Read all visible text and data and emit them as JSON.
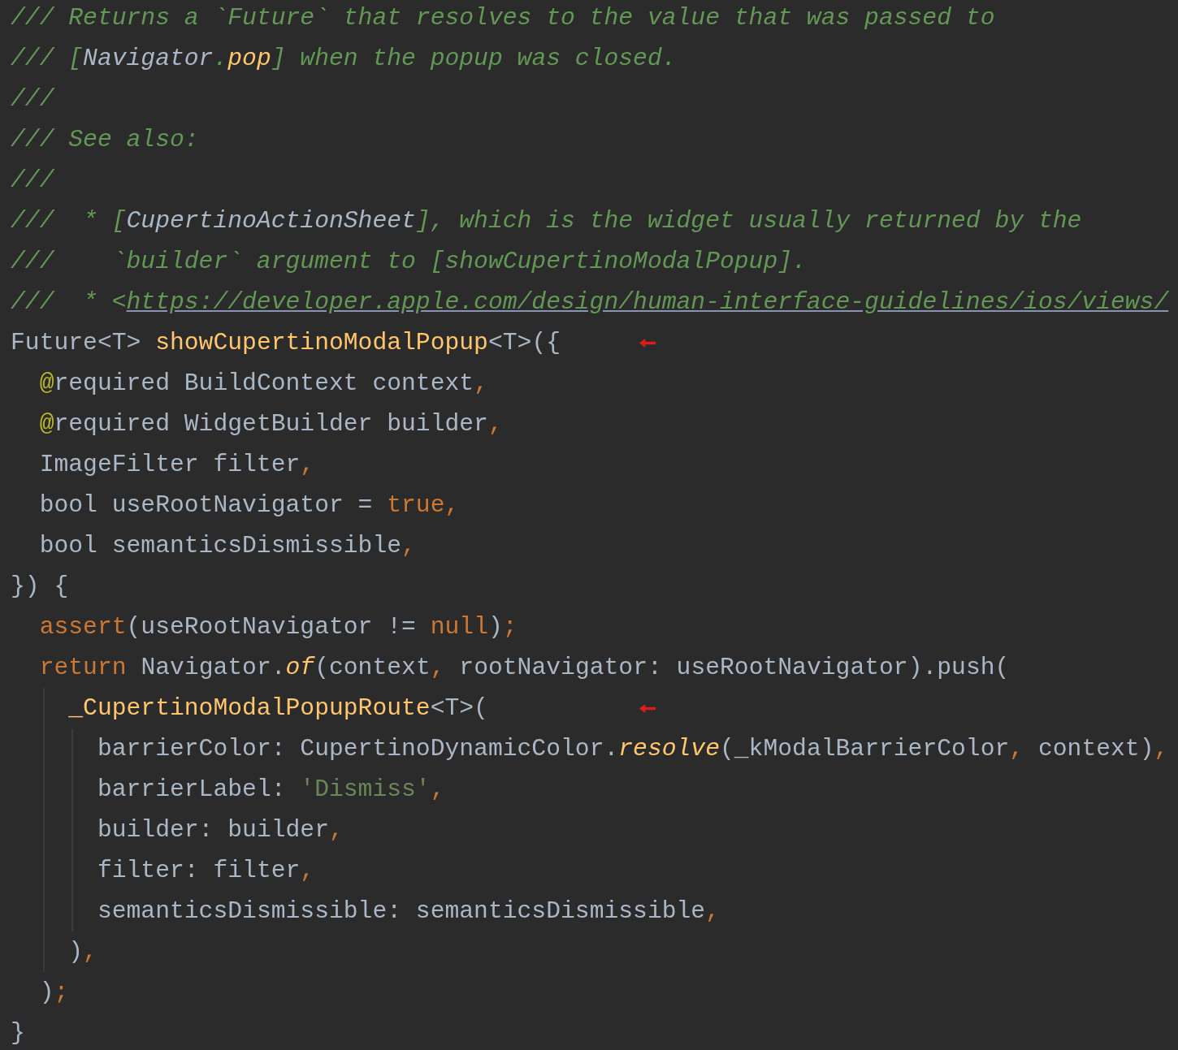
{
  "editor": {
    "lines": [
      {
        "tokens": [
          {
            "kind": "comment",
            "text": "/// Returns a `Future` that resolves to the value that was passed to"
          }
        ]
      },
      {
        "tokens": [
          {
            "kind": "comment",
            "text": "/// ["
          },
          {
            "kind": "comment-ref",
            "text": "Navigator"
          },
          {
            "kind": "comment",
            "text": "."
          },
          {
            "kind": "comment-ref-method",
            "text": "pop"
          },
          {
            "kind": "comment",
            "text": "] when the popup was closed."
          }
        ]
      },
      {
        "tokens": [
          {
            "kind": "comment",
            "text": "///"
          }
        ]
      },
      {
        "tokens": [
          {
            "kind": "comment",
            "text": "/// See also:"
          }
        ]
      },
      {
        "tokens": [
          {
            "kind": "comment",
            "text": "///"
          }
        ]
      },
      {
        "tokens": [
          {
            "kind": "comment",
            "text": "///  * ["
          },
          {
            "kind": "comment-ref",
            "text": "CupertinoActionSheet"
          },
          {
            "kind": "comment",
            "text": "], which is the widget usually returned by the"
          }
        ]
      },
      {
        "tokens": [
          {
            "kind": "comment",
            "text": "///    `builder` argument to [showCupertinoModalPopup]."
          }
        ]
      },
      {
        "tokens": [
          {
            "kind": "comment",
            "text": "///  * <"
          },
          {
            "kind": "link",
            "text": "https://developer.apple.com/design/human-interface-guidelines/ios/views/"
          }
        ]
      },
      {
        "marker": true,
        "tokens": [
          {
            "kind": "plain",
            "text": "Future<T> "
          },
          {
            "kind": "function",
            "text": "showCupertinoModalPopup"
          },
          {
            "kind": "plain",
            "text": "<T>({"
          }
        ]
      },
      {
        "tokens": [
          {
            "kind": "annotation",
            "text": "  @"
          },
          {
            "kind": "plain",
            "text": "required BuildContext context"
          },
          {
            "kind": "punct",
            "text": ","
          }
        ]
      },
      {
        "tokens": [
          {
            "kind": "annotation",
            "text": "  @"
          },
          {
            "kind": "plain",
            "text": "required WidgetBuilder builder"
          },
          {
            "kind": "punct",
            "text": ","
          }
        ]
      },
      {
        "tokens": [
          {
            "kind": "plain",
            "text": "  ImageFilter filter"
          },
          {
            "kind": "punct",
            "text": ","
          }
        ]
      },
      {
        "tokens": [
          {
            "kind": "plain",
            "text": "  bool useRootNavigator = "
          },
          {
            "kind": "keyword",
            "text": "true"
          },
          {
            "kind": "punct",
            "text": ","
          }
        ]
      },
      {
        "tokens": [
          {
            "kind": "plain",
            "text": "  bool semanticsDismissible"
          },
          {
            "kind": "punct",
            "text": ","
          }
        ]
      },
      {
        "tokens": [
          {
            "kind": "plain",
            "text": "}) {"
          }
        ]
      },
      {
        "tokens": [
          {
            "kind": "keyword",
            "text": "  assert"
          },
          {
            "kind": "plain",
            "text": "(useRootNavigator != "
          },
          {
            "kind": "keyword",
            "text": "null"
          },
          {
            "kind": "plain",
            "text": ")"
          },
          {
            "kind": "punct",
            "text": ";"
          }
        ]
      },
      {
        "tokens": [
          {
            "kind": "keyword",
            "text": "  return"
          },
          {
            "kind": "plain",
            "text": " Navigator."
          },
          {
            "kind": "method-italic",
            "text": "of"
          },
          {
            "kind": "plain",
            "text": "(context"
          },
          {
            "kind": "punct",
            "text": ","
          },
          {
            "kind": "plain",
            "text": " rootNavigator: useRootNavigator).push("
          }
        ]
      },
      {
        "marker": true,
        "tokens": [
          {
            "kind": "function",
            "text": "    _CupertinoModalPopupRoute"
          },
          {
            "kind": "plain",
            "text": "<T>("
          }
        ]
      },
      {
        "tokens": [
          {
            "kind": "plain",
            "text": "      barrierColor: CupertinoDynamicColor."
          },
          {
            "kind": "method-italic",
            "text": "resolve"
          },
          {
            "kind": "plain",
            "text": "(_kModalBarrierColor"
          },
          {
            "kind": "punct",
            "text": ","
          },
          {
            "kind": "plain",
            "text": " context)"
          },
          {
            "kind": "punct",
            "text": ","
          }
        ]
      },
      {
        "tokens": [
          {
            "kind": "plain",
            "text": "      barrierLabel: "
          },
          {
            "kind": "string",
            "text": "'Dismiss'"
          },
          {
            "kind": "punct",
            "text": ","
          }
        ]
      },
      {
        "tokens": [
          {
            "kind": "plain",
            "text": "      builder: builder"
          },
          {
            "kind": "punct",
            "text": ","
          }
        ]
      },
      {
        "tokens": [
          {
            "kind": "plain",
            "text": "      filter: filter"
          },
          {
            "kind": "punct",
            "text": ","
          }
        ]
      },
      {
        "tokens": [
          {
            "kind": "plain",
            "text": "      semanticsDismissible: semanticsDismissible"
          },
          {
            "kind": "punct",
            "text": ","
          }
        ]
      },
      {
        "tokens": [
          {
            "kind": "plain",
            "text": "    )"
          },
          {
            "kind": "punct",
            "text": ","
          }
        ]
      },
      {
        "tokens": [
          {
            "kind": "plain",
            "text": "  )"
          },
          {
            "kind": "punct",
            "text": ";"
          }
        ]
      },
      {
        "tokens": [
          {
            "kind": "plain",
            "text": "}"
          }
        ]
      }
    ]
  }
}
